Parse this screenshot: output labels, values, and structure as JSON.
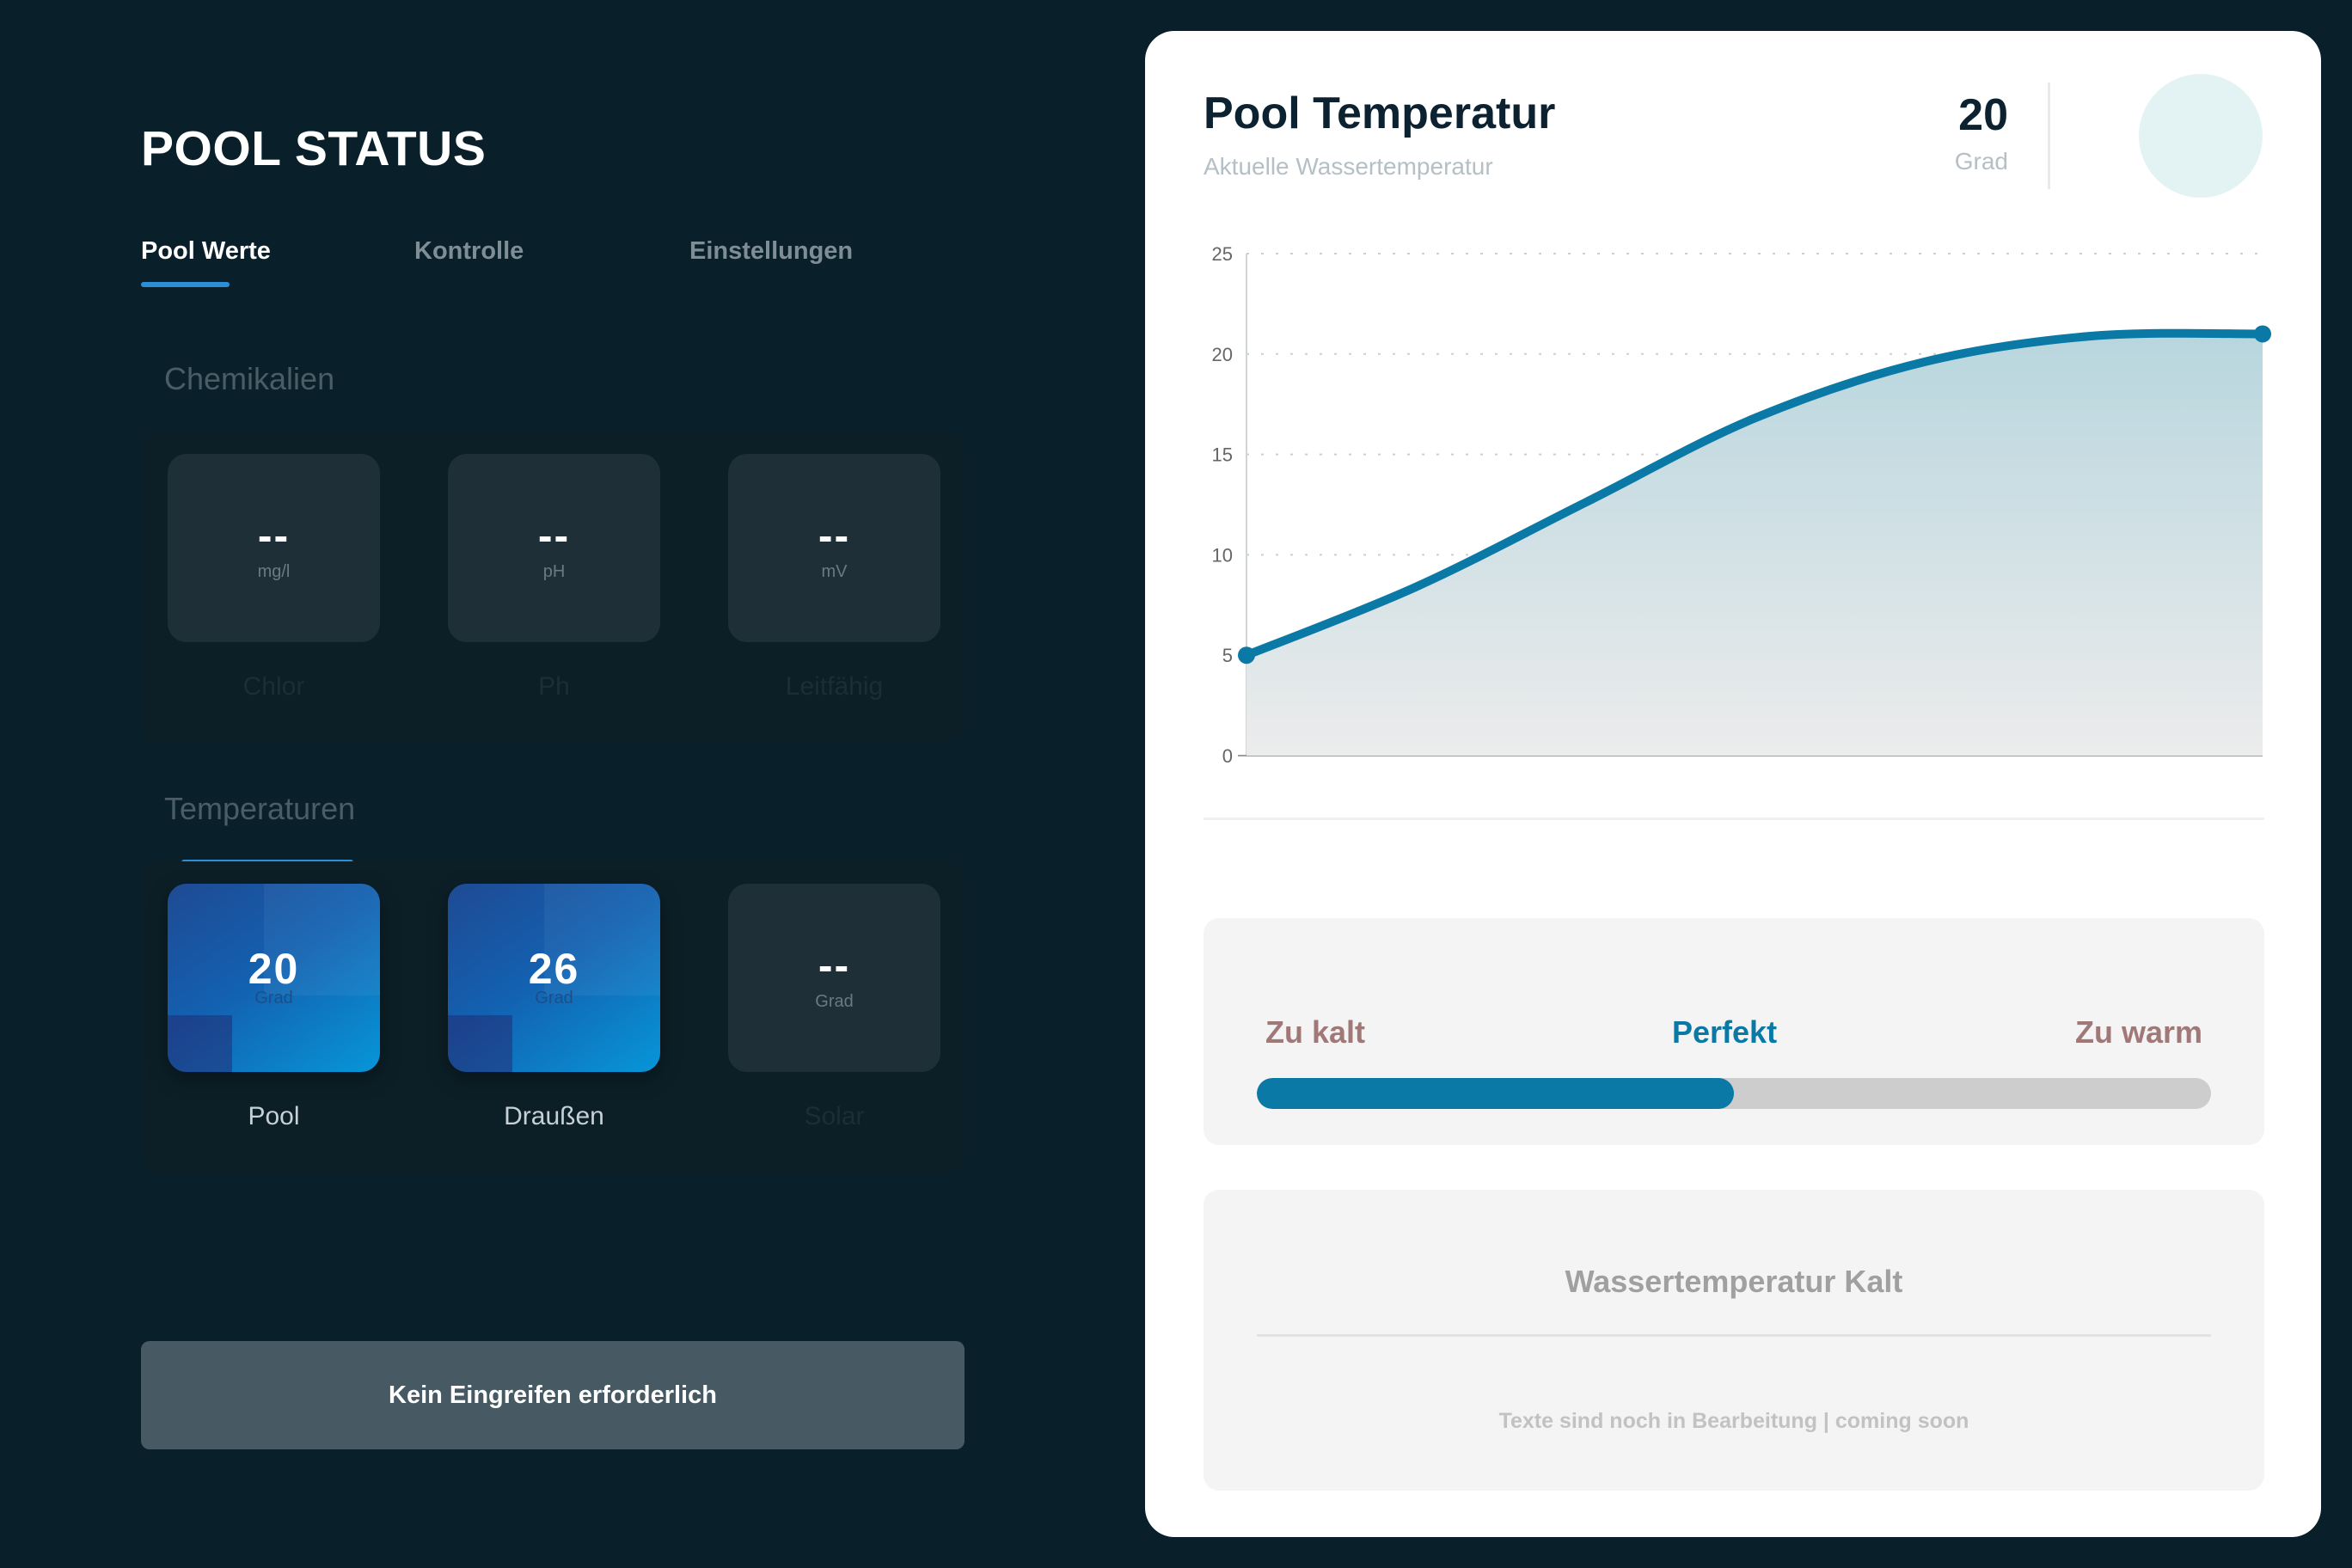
{
  "header": {
    "title": "POOL STATUS"
  },
  "tabs": [
    {
      "label": "Pool Werte",
      "active": true
    },
    {
      "label": "Kontrolle",
      "active": false
    },
    {
      "label": "Einstellungen",
      "active": false
    }
  ],
  "chemicals": {
    "title": "Chemikalien",
    "tiles": [
      {
        "value": "--",
        "unit": "mg/l",
        "label": "Chlor"
      },
      {
        "value": "--",
        "unit": "pH",
        "label": "Ph"
      },
      {
        "value": "--",
        "unit": "mV",
        "label": "Leitfähig"
      }
    ]
  },
  "temperatures": {
    "title": "Temperaturen",
    "tiles": [
      {
        "value": "20",
        "unit": "Grad",
        "label": "Pool"
      },
      {
        "value": "26",
        "unit": "Grad",
        "label": "Draußen"
      },
      {
        "value": "--",
        "unit": "Grad",
        "label": "Solar"
      }
    ]
  },
  "action_button": {
    "label": "Kein Eingreifen erforderlich"
  },
  "card": {
    "title": "Pool Temperatur",
    "subtitle": "Aktuelle Wassertemperatur",
    "temperature_value": "20",
    "temperature_unit": "Grad"
  },
  "chart_data": {
    "type": "area",
    "x": [
      0,
      1,
      2,
      3,
      4,
      5,
      6
    ],
    "values": [
      5,
      8.4,
      12.6,
      16.8,
      19.6,
      20.9,
      21
    ],
    "y_ticks": [
      0,
      5,
      10,
      15,
      20,
      25
    ],
    "ylim": [
      0,
      25
    ],
    "grid": true,
    "title": "",
    "xlabel": "",
    "ylabel": "",
    "colors": {
      "line": "#0a79a6",
      "fill_top": "#b8d6de",
      "fill_bottom": "#ececec"
    }
  },
  "range": {
    "labels": {
      "cold": "Zu kalt",
      "perfect": "Perfekt",
      "warm": "Zu warm"
    },
    "fill_fraction": 0.5,
    "colors": {
      "cold": "#a07878",
      "perfect": "#0a79a6",
      "warm": "#a07878"
    }
  },
  "info": {
    "title": "Wassertemperatur Kalt",
    "text": "Texte sind noch in Bearbeitung | coming soon"
  }
}
